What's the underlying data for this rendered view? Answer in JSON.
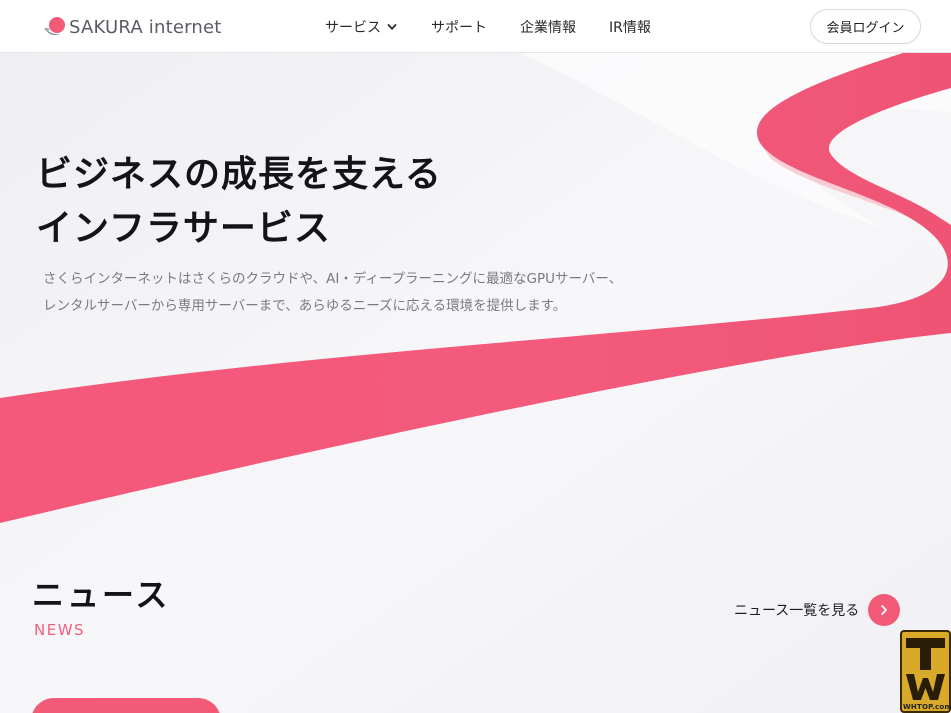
{
  "brand": {
    "logo_text": "SAKURA internet",
    "accent_color": "#f25a78"
  },
  "nav": {
    "items": [
      {
        "label": "サービス",
        "has_dropdown": true,
        "icon": "chevron-down-icon"
      },
      {
        "label": "サポート"
      },
      {
        "label": "企業情報"
      },
      {
        "label": "IR情報"
      }
    ],
    "login_label": "会員ログイン"
  },
  "hero": {
    "title_line1": "ビジネスの成長を支える",
    "title_line2": "インフラサービス",
    "desc_line1": "さくらインターネットはさくらのクラウドや、AI・ディープラーニングに最適なGPUサーバー、",
    "desc_line2": "レンタルサーバーから専用サーバーまで、あらゆるニーズに応える環境を提供します。"
  },
  "news": {
    "title": "ニュース",
    "subtitle": "NEWS",
    "view_all_label": "ニュース一覧を見る",
    "view_all_icon": "chevron-right-icon"
  },
  "watermark": {
    "text": "WHTOP.com"
  }
}
